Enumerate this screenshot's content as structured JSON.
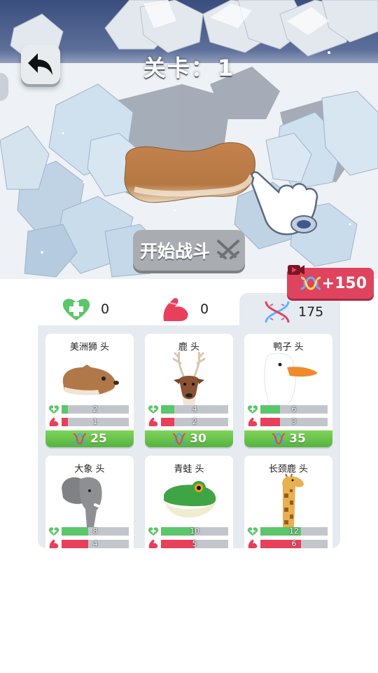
{
  "header": {
    "level_label": "关卡：",
    "level_value": "1"
  },
  "scene": {
    "start_battle_label": "开始战斗",
    "video_reward_label": "+150"
  },
  "stats": {
    "health": "0",
    "power": "0",
    "dna": "175"
  },
  "cards": [
    {
      "name": "美洲狮 头",
      "hp": "2",
      "atk": "1",
      "hp_level": 0.09,
      "atk_level": 0.09,
      "cost": "25",
      "icon": "cougar-head"
    },
    {
      "name": "鹿 头",
      "hp": "4",
      "atk": "2",
      "hp_level": 0.2,
      "atk_level": 0.2,
      "cost": "30",
      "icon": "deer-head"
    },
    {
      "name": "鸭子 头",
      "hp": "6",
      "atk": "3",
      "hp_level": 0.29,
      "atk_level": 0.29,
      "cost": "35",
      "icon": "duck-head"
    },
    {
      "name": "大象 头",
      "hp": "8",
      "atk": "4",
      "hp_level": 0.4,
      "atk_level": 0.4,
      "cost": "",
      "icon": "elephant-head"
    },
    {
      "name": "青蛙 头",
      "hp": "10",
      "atk": "5",
      "hp_level": 0.5,
      "atk_level": 0.5,
      "cost": "",
      "icon": "frog-head"
    },
    {
      "name": "长颈鹿 头",
      "hp": "12",
      "atk": "6",
      "hp_level": 0.6,
      "atk_level": 0.6,
      "cost": "",
      "icon": "giraffe-head"
    }
  ],
  "colors": {
    "health_green": "#5cc66a",
    "attack_red": "#e8405a",
    "cost_green": "#5cb843",
    "reward_red": "#e0435e"
  }
}
